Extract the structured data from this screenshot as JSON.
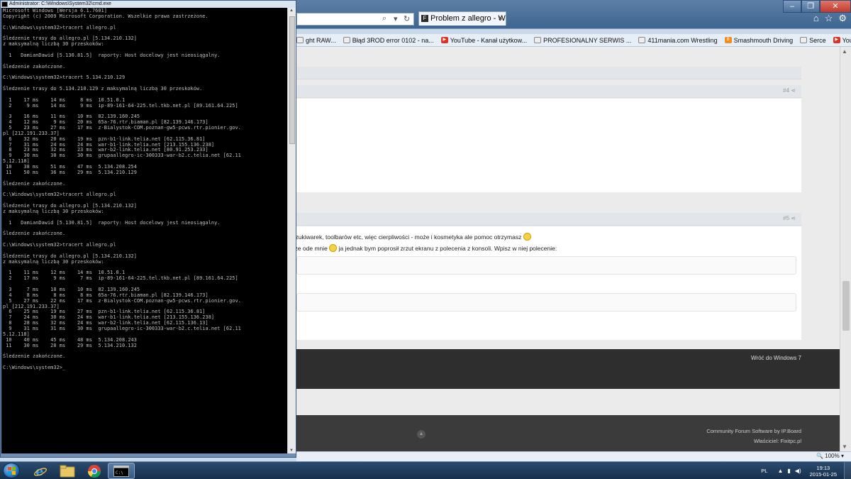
{
  "browser": {
    "tab_title": "Problem z allegro - Windo...",
    "tab_favicon": "F",
    "favorites": [
      {
        "icon": "page-icon",
        "label": "ght RAW..."
      },
      {
        "icon": "page-icon",
        "label": "Błąd 3ROD error 0102 - na..."
      },
      {
        "icon": "youtube-icon",
        "label": "YouTube - Kanał użytkow..."
      },
      {
        "icon": "page-icon",
        "label": "PROFESIONALNY SERWIS ..."
      },
      {
        "icon": "page-icon",
        "label": "411mania.com Wrestling"
      },
      {
        "icon": "blogger-icon",
        "label": "Smashmouth Driving"
      },
      {
        "icon": "page-icon",
        "label": "Serce"
      },
      {
        "icon": "youtube-icon",
        "label": "YouTube - Kanał użytkow..."
      }
    ],
    "zoom": "100%"
  },
  "forum": {
    "post4_number": "#4",
    "post5_number": "#5",
    "post5_line1_a": "yszukiwarek, toolbarów etc, więc cierpliwości - może i kosmetyka ale pomoc otrzymasz",
    "post5_line2_a": "arze ode mnie",
    "post5_line2_b": "ja jednak bym poprosił zrzut ekranu z polecenia z konsoli. Wpisz w niej polecenie:",
    "back_link": "Wróć do Windows 7",
    "footer_line1": "Community Forum Software by IP.Board",
    "footer_line2": "Właściciel: Fixitpc.pl"
  },
  "cmd": {
    "title": "Administrator: C:\\Windows\\System32\\cmd.exe",
    "output": "Microsoft Windows [Wersja 6.1.7601]\nCopyright (c) 2009 Microsoft Corporation. Wszelkie prawa zastrzeżone.\n\nC:\\Windows\\system32>tracert allegro.pl\n\nŚledzenie trasy do allegro.pl [5.134.210.132]\nz maksymalną liczbą 30 przeskoków:\n\n  1   DamianDawid [5.130.81.5]  raporty: Host docelowy jest nieosiągalny.\n\nŚledzenie zakończone.\n\nC:\\Windows\\system32>tracert 5.134.210.129\n\nŚledzenie trasy do 5.134.210.129 z maksymalną liczbą 30 przeskoków.\n\n  1    17 ms    14 ms     8 ms  10.51.0.1\n  2     9 ms    14 ms     9 ms  ip-89-161-64-225.tel.tkb.net.pl [89.161.64.225]\n\n  3    16 ms    11 ms    10 ms  82.139.160.245\n  4    12 ms     9 ms    20 ms  65a-76.rtr.biaman.pl [82.139.146.173]\n  5    23 ms    27 ms    17 ms  z-Bialystok-COM.poznan-gw5-pcws.rtr.pionier.gov.\npl [212.191.233.37]\n  6    32 ms    20 ms    19 ms  pzn-b1-link.telia.net [62.115.36.81]\n  7    31 ms    24 ms    24 ms  war-b1-link.telia.net [213.155.136.238]\n  8    23 ms    32 ms    23 ms  war-b2-link.telia.net [80.91.253.233]\n  9    30 ms    30 ms    30 ms  grupaallegro-ic-300333-war-b2.c.telia.net [62.11\n5.12.118]\n 10    38 ms    51 ms    47 ms  5.134.208.254\n 11    50 ms    36 ms    29 ms  5.134.210.129\n\nŚledzenie zakończone.\n\nC:\\Windows\\system32>tracert allegro.pl\n\nŚledzenie trasy do allegro.pl [5.134.210.132]\nz maksymalną liczbą 30 przeskoków:\n\n  1   DamianDawid [5.130.81.5]  raporty: Host docelowy jest nieosiągalny.\n\nŚledzenie zakończone.\n\nC:\\Windows\\system32>tracert allegro.pl\n\nŚledzenie trasy do allegro.pl [5.134.210.132]\nz maksymalną liczbą 30 przeskoków:\n\n  1    11 ms    12 ms    14 ms  10.51.0.1\n  2    17 ms     9 ms     7 ms  ip-89-161-64-225.tel.tkb.net.pl [89.161.64.225]\n\n  3     7 ms    18 ms    10 ms  82.139.160.245\n  4     8 ms     8 ms     8 ms  65a-76.rtr.biaman.pl [82.139.146.173]\n  5    27 ms    22 ms    17 ms  z-Bialystok-COM.poznan-gw5-pcws.rtr.pionier.gov.\npl [212.191.233.37]\n  6    25 ms    19 ms    27 ms  pzn-b1-link.telia.net [62.115.36.81]\n  7    24 ms    30 ms    24 ms  war-b1-link.telia.net [213.155.136.238]\n  8    28 ms    32 ms    24 ms  war-b2-link.telia.net [62.115.136.13]\n  9    31 ms    31 ms    30 ms  grupaallegro-ic-300333-war-b2.c.telia.net [62.11\n5.12.118]\n 10    40 ms    45 ms    48 ms  5.134.208.243\n 11    30 ms    28 ms    29 ms  5.134.210.132\n\nŚledzenie zakończone.\n\nC:\\Windows\\system32>_"
  },
  "taskbar": {
    "apps": [
      "internet-explorer-icon",
      "file-explorer-icon",
      "chrome-icon",
      "cmd-icon"
    ],
    "language": "PL",
    "time": "19:13",
    "date": "2015-01-25"
  },
  "colors": {
    "console_bg": "#000000",
    "console_fg": "#c0c0c0",
    "taskbar": "#1e3a5c",
    "forum_dark": "#2e2e2e"
  }
}
